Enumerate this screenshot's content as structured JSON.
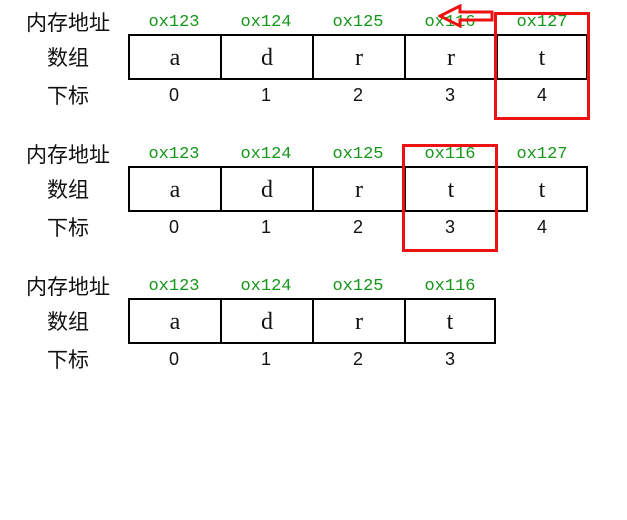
{
  "labels": {
    "memory_address": "内存地址",
    "array": "数组",
    "index": "下标"
  },
  "colors": {
    "address_text": "#159719",
    "highlight_border": "#e11"
  },
  "arrow": {
    "direction": "left",
    "color": "#e11"
  },
  "blocks": [
    {
      "addresses": [
        "ox123",
        "ox124",
        "ox125",
        "ox116",
        "ox127"
      ],
      "values": [
        "a",
        "d",
        "r",
        "r",
        "t"
      ],
      "indices": [
        "0",
        "1",
        "2",
        "3",
        "4"
      ],
      "highlight_index": 4,
      "has_arrow": true
    },
    {
      "addresses": [
        "ox123",
        "ox124",
        "ox125",
        "ox116",
        "ox127"
      ],
      "values": [
        "a",
        "d",
        "r",
        "t",
        "t"
      ],
      "indices": [
        "0",
        "1",
        "2",
        "3",
        "4"
      ],
      "highlight_index": 3,
      "has_arrow": false
    },
    {
      "addresses": [
        "ox123",
        "ox124",
        "ox125",
        "ox116"
      ],
      "values": [
        "a",
        "d",
        "r",
        "t"
      ],
      "indices": [
        "0",
        "1",
        "2",
        "3"
      ],
      "highlight_index": null,
      "has_arrow": false
    }
  ]
}
